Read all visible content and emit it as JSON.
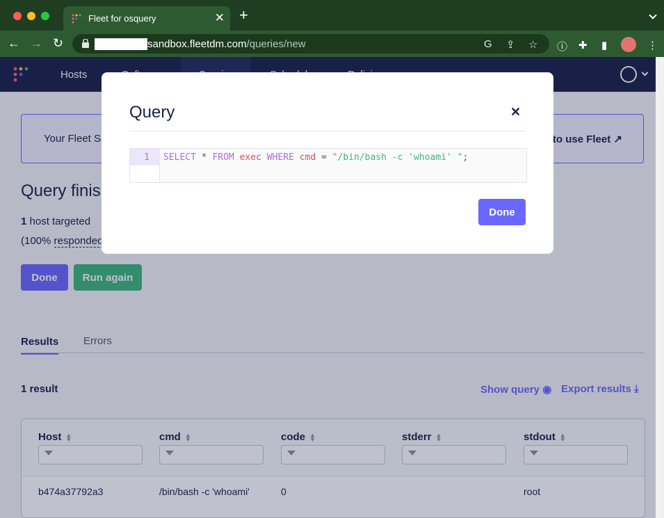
{
  "browser": {
    "tab_title": "Fleet for osquery",
    "url_host": "sandbox.fleetdm.com",
    "url_path": "/queries/new"
  },
  "header": {
    "nav": [
      "Hosts",
      "Soft",
      "Queries",
      "Schedule",
      "Policies"
    ]
  },
  "banner": {
    "text": "Your Fleet Sa",
    "link": "to use Fleet"
  },
  "page": {
    "title": "Query finis",
    "hosts_count": "1",
    "hosts_label": "host targeted",
    "responded_prefix": "(100%",
    "responded_link": "responded",
    "done_label": "Done",
    "run_again_label": "Run again"
  },
  "tabs": {
    "results": "Results",
    "errors": "Errors"
  },
  "results": {
    "count": "1 result",
    "show_query": "Show query",
    "export": "Export results"
  },
  "table": {
    "columns": [
      "Host",
      "cmd",
      "code",
      "stderr",
      "stdout"
    ],
    "rows": [
      [
        "b474a37792a3",
        "/bin/bash -c 'whoami'",
        "0",
        "",
        "root"
      ]
    ]
  },
  "modal": {
    "title": "Query",
    "line_number": "1",
    "sql": {
      "kw1": "SELECT",
      "star": " * ",
      "kw2": "FROM",
      "table": " exec ",
      "kw3": "WHERE",
      "col": " cmd ",
      "op": "= ",
      "str": "\"/bin/bash -c 'whoami' \"",
      "end": ";"
    },
    "done_label": "Done"
  },
  "colors": {
    "brand": "#6a67fe",
    "success": "#3db67b",
    "navy": "#192147"
  }
}
